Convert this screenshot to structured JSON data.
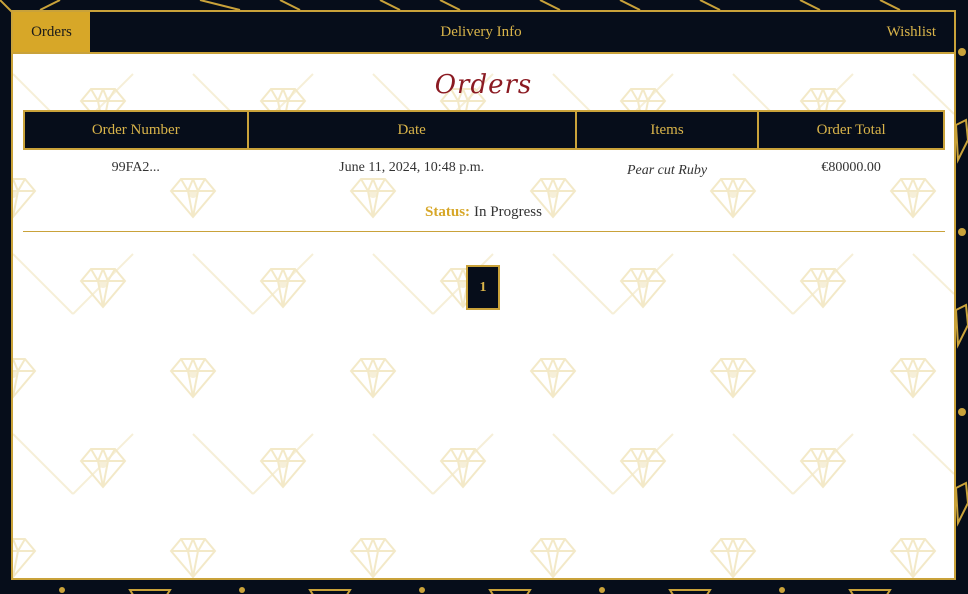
{
  "nav": {
    "orders": "Orders",
    "delivery": "Delivery Info",
    "wishlist": "Wishlist"
  },
  "page": {
    "title": "Orders"
  },
  "table": {
    "headers": [
      "Order Number",
      "Date",
      "Items",
      "Order Total"
    ],
    "rows": [
      {
        "order_number": "99FA2...",
        "date": "June 11, 2024, 10:48 p.m.",
        "items": "Pear cut Ruby",
        "total": "€80000.00"
      }
    ]
  },
  "status": {
    "label": "Status:",
    "value": "In Progress"
  },
  "pagination": {
    "current": "1"
  },
  "colors": {
    "navy": "#060d1a",
    "gold": "#c9a23a",
    "accent": "#d7a728",
    "burgundy": "#8b1a22"
  },
  "icons": [
    "diamond-icon"
  ]
}
